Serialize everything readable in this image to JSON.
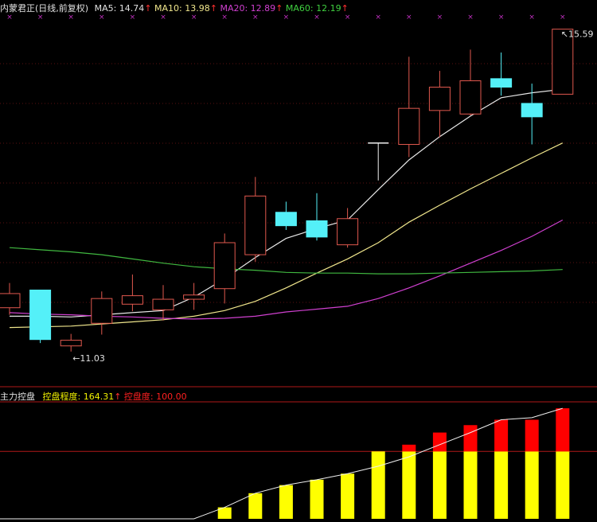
{
  "header": {
    "stock": "内蒙君正(日线,前复权)",
    "ma5": "MA5: 14.74",
    "ma10": "MA10: 13.98",
    "ma20": "MA20: 12.89",
    "ma60": "MA60: 12.19",
    "arrow": "↑"
  },
  "indicator": {
    "name": "主力控盘",
    "degree": "控盘程度: 164.31",
    "control": "控盘度: 100.00",
    "arrow": "↑"
  },
  "chart_data": {
    "type": "candlestick",
    "price_ylim": [
      10.6,
      15.8
    ],
    "annotations": {
      "low": "11.03",
      "high": "15.59"
    },
    "candles": [
      {
        "o": 11.85,
        "c": 11.65,
        "h": 12.0,
        "l": 11.55,
        "color": "red"
      },
      {
        "o": 11.9,
        "c": 11.2,
        "h": 11.9,
        "l": 11.15,
        "color": "cyan"
      },
      {
        "o": 11.19,
        "c": 11.11,
        "h": 11.28,
        "l": 11.03,
        "color": "red"
      },
      {
        "o": 11.43,
        "c": 11.78,
        "h": 11.88,
        "l": 11.27,
        "color": "red"
      },
      {
        "o": 11.7,
        "c": 11.82,
        "h": 12.12,
        "l": 11.6,
        "color": "red"
      },
      {
        "o": 11.62,
        "c": 11.77,
        "h": 11.97,
        "l": 11.47,
        "color": "red"
      },
      {
        "o": 11.77,
        "c": 11.83,
        "h": 12.0,
        "l": 11.62,
        "color": "red"
      },
      {
        "o": 11.92,
        "c": 12.57,
        "h": 12.7,
        "l": 11.71,
        "color": "red"
      },
      {
        "o": 12.4,
        "c": 13.23,
        "h": 13.5,
        "l": 12.3,
        "color": "red"
      },
      {
        "o": 13.0,
        "c": 12.81,
        "h": 13.15,
        "l": 12.75,
        "color": "cyan"
      },
      {
        "o": 12.88,
        "c": 12.65,
        "h": 13.27,
        "l": 12.6,
        "color": "cyan"
      },
      {
        "o": 12.54,
        "c": 12.91,
        "h": 13.06,
        "l": 12.5,
        "color": "red"
      },
      {
        "o": 13.98,
        "c": 13.98,
        "h": 13.98,
        "l": 13.45,
        "color": "white"
      },
      {
        "o": 13.96,
        "c": 14.47,
        "h": 15.2,
        "l": 13.78,
        "color": "red"
      },
      {
        "o": 14.44,
        "c": 14.77,
        "h": 15.0,
        "l": 14.06,
        "color": "red"
      },
      {
        "o": 14.39,
        "c": 14.86,
        "h": 15.3,
        "l": 14.37,
        "color": "red"
      },
      {
        "o": 14.89,
        "c": 14.77,
        "h": 15.26,
        "l": 14.65,
        "color": "cyan"
      },
      {
        "o": 14.54,
        "c": 14.35,
        "h": 14.82,
        "l": 13.96,
        "color": "cyan"
      },
      {
        "o": 14.67,
        "c": 15.59,
        "h": 15.59,
        "l": 14.67,
        "color": "red"
      }
    ],
    "ma_series": [
      {
        "name": "MA5",
        "color": "#e8e8e8",
        "values": [
          11.53,
          11.53,
          11.52,
          11.55,
          11.58,
          11.61,
          11.8,
          12.06,
          12.36,
          12.63,
          12.77,
          12.89,
          13.32,
          13.74,
          14.07,
          14.36,
          14.62,
          14.69,
          14.74
        ]
      },
      {
        "name": "MA10",
        "color": "#f0e68c",
        "values": [
          11.37,
          11.38,
          11.39,
          11.42,
          11.45,
          11.48,
          11.53,
          11.61,
          11.74,
          11.93,
          12.14,
          12.34,
          12.57,
          12.86,
          13.1,
          13.33,
          13.55,
          13.77,
          13.98
        ]
      },
      {
        "name": "MA20",
        "color": "#d040d0",
        "values": [
          11.58,
          11.56,
          11.55,
          11.53,
          11.52,
          11.5,
          11.49,
          11.5,
          11.53,
          11.59,
          11.63,
          11.67,
          11.78,
          11.93,
          12.1,
          12.28,
          12.46,
          12.66,
          12.89
        ]
      },
      {
        "name": "MA60",
        "color": "#40b840",
        "values": [
          12.5,
          12.47,
          12.44,
          12.4,
          12.34,
          12.28,
          12.23,
          12.2,
          12.18,
          12.15,
          12.14,
          12.14,
          12.13,
          12.13,
          12.14,
          12.15,
          12.16,
          12.17,
          12.19
        ]
      }
    ],
    "indicator_ylim": [
      0,
      170
    ],
    "control_bars": [
      0,
      0,
      0,
      0,
      0,
      0,
      0,
      17,
      38,
      50,
      58,
      67,
      100,
      110,
      128,
      139,
      147,
      147,
      164
    ],
    "control_line": [
      0,
      0,
      0,
      0,
      0,
      0,
      0,
      17,
      38,
      50,
      58,
      67,
      78,
      92,
      110,
      128,
      147,
      150,
      164
    ],
    "bar_split": 100
  }
}
